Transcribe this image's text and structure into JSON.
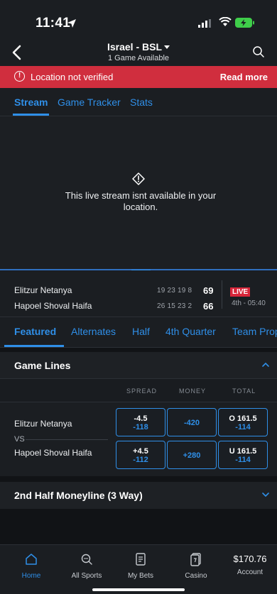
{
  "status_bar": {
    "time": "11:41"
  },
  "nav": {
    "title": "Israel - BSL",
    "subtitle": "1 Game Available"
  },
  "banner": {
    "message": "Location not verified",
    "link": "Read more"
  },
  "stream_tabs": [
    "Stream",
    "Game Tracker",
    "Stats"
  ],
  "video": {
    "message": "This live stream isnt available in your location."
  },
  "scoreboard": {
    "teams": [
      {
        "name": "Elitzur Netanya",
        "periods": "19 23 19 8",
        "total": "69"
      },
      {
        "name": "Hapoel Shoval Haifa",
        "periods": "26 15 23 2",
        "total": "66"
      }
    ],
    "status": "LIVE",
    "clock": "4th - 05:40"
  },
  "market_tabs": [
    "Featured",
    "Alternates",
    "Half",
    "4th Quarter",
    "Team Props"
  ],
  "game_lines": {
    "title": "Game Lines",
    "columns": [
      "SPREAD",
      "MONEY",
      "TOTAL"
    ],
    "team1": "Elitzur Netanya",
    "vs": "VS",
    "team2": "Hapoel Shoval Haifa",
    "odds": {
      "t1_spread_line": "-4.5",
      "t1_spread_price": "-118",
      "t1_money": "-420",
      "t1_total_line": "O 161.5",
      "t1_total_price": "-114",
      "t2_spread_line": "+4.5",
      "t2_spread_price": "-112",
      "t2_money": "+280",
      "t2_total_line": "U 161.5",
      "t2_total_price": "-114"
    }
  },
  "second_half": {
    "title": "2nd Half Moneyline (3 Way)"
  },
  "bottom_nav": {
    "home": "Home",
    "all_sports": "All Sports",
    "my_bets": "My Bets",
    "casino": "Casino",
    "balance": "$170.76",
    "account": "Account"
  },
  "colors": {
    "accent": "#2f8fe8",
    "alert": "#d02e3e",
    "background": "#1a1d21"
  },
  "icons": [
    "location-arrow-icon",
    "signal-icon",
    "wifi-icon",
    "battery-icon",
    "back-chevron-icon",
    "search-icon",
    "warning-circle-icon",
    "diamond-alert-icon",
    "chevron-down-icon",
    "chevron-up-icon",
    "home-icon",
    "all-sports-icon",
    "my-bets-icon",
    "casino-icon"
  ]
}
